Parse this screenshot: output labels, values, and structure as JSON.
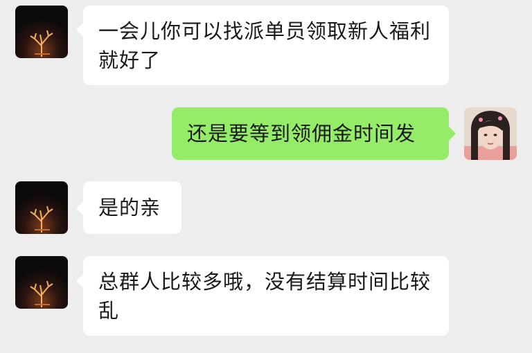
{
  "messages": [
    {
      "direction": "incoming",
      "avatar_icon": "night-tree-avatar-icon",
      "text": "一会儿你可以找派单员领取新人福利就好了"
    },
    {
      "direction": "outgoing",
      "avatar_icon": "girl-photo-avatar-icon",
      "text": "还是要等到领佣金时间发"
    },
    {
      "direction": "incoming",
      "avatar_icon": "night-tree-avatar-icon",
      "text": "是的亲"
    },
    {
      "direction": "incoming",
      "avatar_icon": "night-tree-avatar-icon",
      "text": "总群人比较多哦，没有结算时间比较乱"
    }
  ],
  "colors": {
    "background": "#ededed",
    "incoming_bubble": "#ffffff",
    "outgoing_bubble": "#95ec69"
  }
}
